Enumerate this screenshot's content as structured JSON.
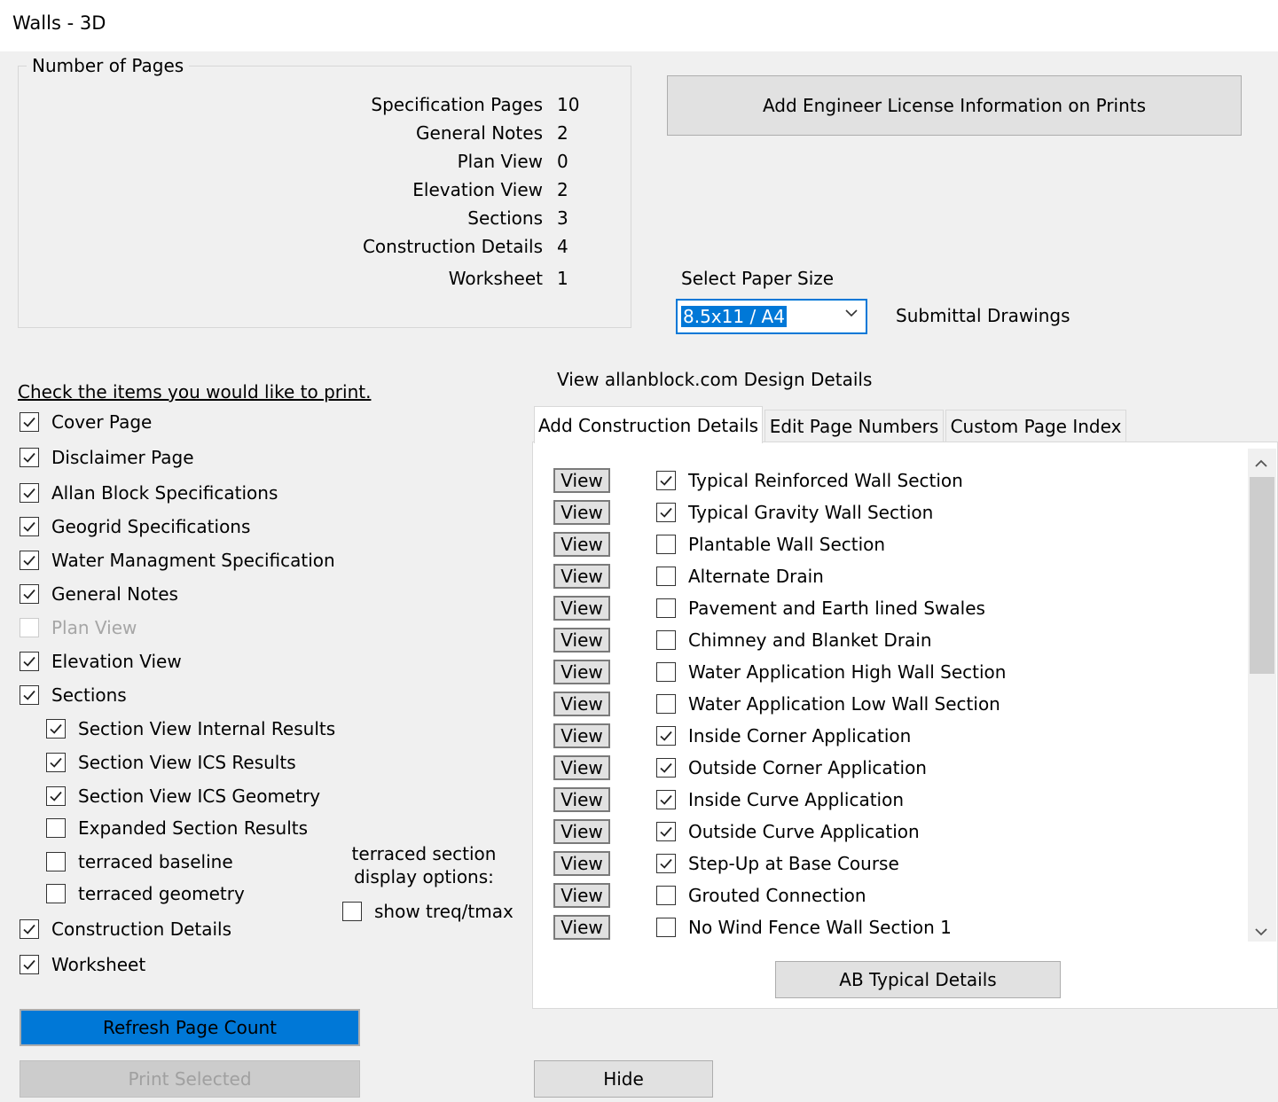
{
  "window": {
    "title": "Walls - 3D"
  },
  "pages": {
    "legend": "Number of Pages",
    "counts": [
      {
        "label": "Specification Pages",
        "value": "10"
      },
      {
        "label": "General Notes",
        "value": "2"
      },
      {
        "label": "Plan View",
        "value": "0"
      },
      {
        "label": "Elevation View",
        "value": "2"
      },
      {
        "label": "Sections",
        "value": "3"
      },
      {
        "label": "Construction Details",
        "value": "4"
      },
      {
        "label": "Worksheet",
        "value": "1"
      }
    ]
  },
  "engineer_button": "Add Engineer License Information on Prints",
  "paper": {
    "label": "Select Paper Size",
    "selected": "8.5x11 / A4",
    "submittal": "Submittal Drawings"
  },
  "design_details_link": "View allanblock.com Design Details",
  "print_items": {
    "heading": "Check the items you would like to print.",
    "items": [
      {
        "label": "Cover Page",
        "checked": true
      },
      {
        "label": "Disclaimer Page",
        "checked": true
      },
      {
        "label": "Allan Block Specifications",
        "checked": true
      },
      {
        "label": "Geogrid Specifications",
        "checked": true
      },
      {
        "label": "Water Managment Specification",
        "checked": true
      },
      {
        "label": "General Notes",
        "checked": true
      },
      {
        "label": "Plan View",
        "checked": false,
        "disabled": true
      },
      {
        "label": "Elevation View",
        "checked": true
      },
      {
        "label": "Sections",
        "checked": true
      }
    ],
    "section_items": [
      {
        "label": "Section View Internal Results",
        "checked": true
      },
      {
        "label": "Section View ICS Results",
        "checked": true
      },
      {
        "label": "Section View ICS Geometry",
        "checked": true
      },
      {
        "label": "Expanded Section Results",
        "checked": false
      },
      {
        "label": "terraced baseline",
        "checked": false
      },
      {
        "label": "terraced geometry",
        "checked": false
      }
    ],
    "bottom_items": [
      {
        "label": "Construction Details",
        "checked": true
      },
      {
        "label": "Worksheet",
        "checked": true
      }
    ]
  },
  "terraced": {
    "line1": "terraced section",
    "line2": "display options:",
    "option": {
      "label": "show treq/tmax",
      "checked": false
    }
  },
  "tabs": [
    {
      "label": "Add Construction Details",
      "active": true
    },
    {
      "label": "Edit Page Numbers",
      "active": false
    },
    {
      "label": "Custom Page Index",
      "active": false
    }
  ],
  "view_label": "View",
  "details": [
    {
      "label": "Typical Reinforced Wall Section",
      "checked": true
    },
    {
      "label": "Typical Gravity Wall Section",
      "checked": true
    },
    {
      "label": "Plantable Wall Section",
      "checked": false
    },
    {
      "label": "Alternate Drain",
      "checked": false
    },
    {
      "label": "Pavement and Earth lined Swales",
      "checked": false
    },
    {
      "label": "Chimney and Blanket Drain",
      "checked": false
    },
    {
      "label": "Water Application High Wall Section",
      "checked": false
    },
    {
      "label": "Water Application Low Wall Section",
      "checked": false
    },
    {
      "label": "Inside Corner Application",
      "checked": true
    },
    {
      "label": "Outside Corner Application",
      "checked": true
    },
    {
      "label": "Inside Curve Application",
      "checked": true
    },
    {
      "label": "Outside Curve Application",
      "checked": true
    },
    {
      "label": "Step-Up at Base Course",
      "checked": true
    },
    {
      "label": "Grouted Connection",
      "checked": false
    },
    {
      "label": "No Wind Fence Wall Section 1",
      "checked": false
    }
  ],
  "ab_typical_button": "AB Typical Details",
  "refresh_button": "Refresh Page Count",
  "print_button": "Print Selected",
  "hide_button": "Hide"
}
